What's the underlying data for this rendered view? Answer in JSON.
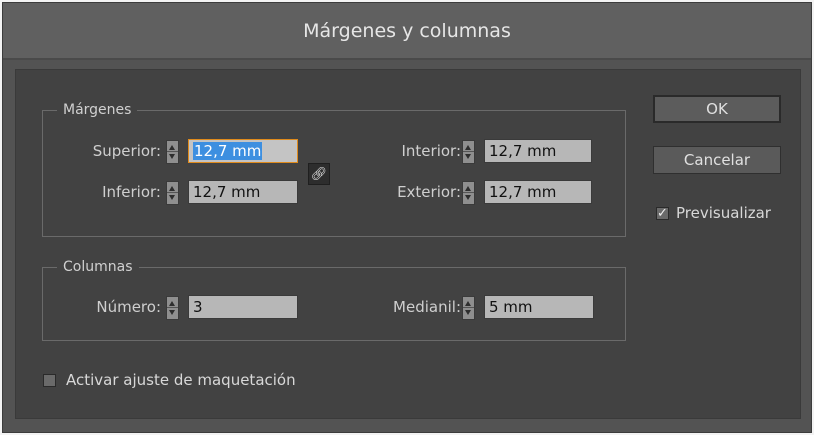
{
  "dialog": {
    "title": "Márgenes y columnas"
  },
  "margins": {
    "legend": "Márgenes",
    "superior": {
      "label": "Superior:",
      "value": "12,7 mm"
    },
    "inferior": {
      "label": "Inferior:",
      "value": "12,7 mm"
    },
    "interior": {
      "label": "Interior:",
      "value": "12,7 mm"
    },
    "exterior": {
      "label": "Exterior:",
      "value": "12,7 mm"
    },
    "link_icon": "chain-link-icon"
  },
  "columns": {
    "legend": "Columnas",
    "numero": {
      "label": "Número:",
      "value": "3"
    },
    "medianil": {
      "label": "Medianil:",
      "value": "5 mm"
    }
  },
  "buttons": {
    "ok": "OK",
    "cancel": "Cancelar"
  },
  "preview": {
    "label": "Previsualizar",
    "checked": true
  },
  "layout_adjust": {
    "label": "Activar ajuste de maquetación",
    "checked": false
  },
  "colors": {
    "dialog_bg": "#424242",
    "titlebar_bg": "#606060",
    "focus_border": "#e08b1c",
    "selection": "#3d8fe0"
  }
}
